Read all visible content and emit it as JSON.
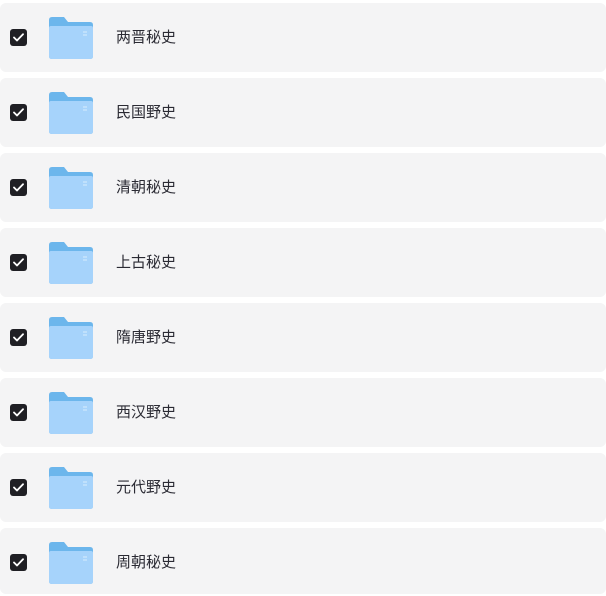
{
  "colors": {
    "row_background": "#f4f4f5",
    "checkbox_fill": "#1f1f24",
    "folder_back": "#6cb6ec",
    "folder_front": "#a6d3fb"
  },
  "items": [
    {
      "label": "两晋秘史",
      "checked": true,
      "icon": "folder-icon"
    },
    {
      "label": "民国野史",
      "checked": true,
      "icon": "folder-icon"
    },
    {
      "label": "清朝秘史",
      "checked": true,
      "icon": "folder-icon"
    },
    {
      "label": "上古秘史",
      "checked": true,
      "icon": "folder-icon"
    },
    {
      "label": "隋唐野史",
      "checked": true,
      "icon": "folder-icon"
    },
    {
      "label": "西汉野史",
      "checked": true,
      "icon": "folder-icon"
    },
    {
      "label": "元代野史",
      "checked": true,
      "icon": "folder-icon"
    },
    {
      "label": "周朝秘史",
      "checked": true,
      "icon": "folder-icon"
    }
  ]
}
